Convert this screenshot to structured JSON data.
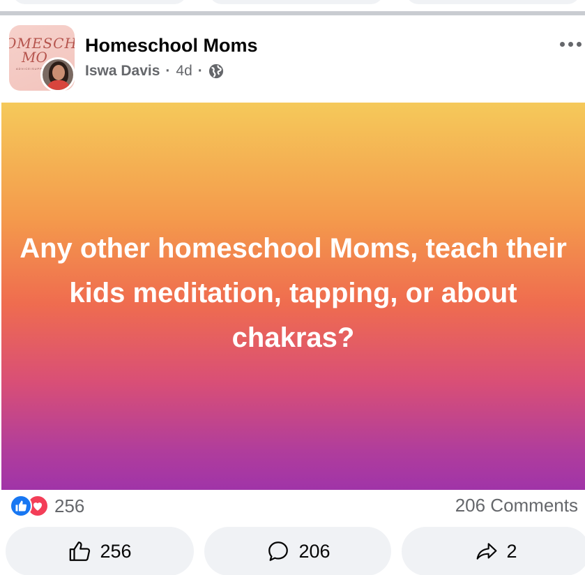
{
  "post": {
    "group_name": "Homeschool Moms",
    "author": "Iswa Davis",
    "separator": "·",
    "time_ago": "4d",
    "privacy_icon": "globe-icon",
    "body_text": "Any other homeschool Moms, teach their kids meditation, tapping, or about chakras?",
    "background_gradient": [
      "#f5c95a",
      "#ef6c4f",
      "#a034a8"
    ]
  },
  "group_avatar": {
    "logo_line1": "OMESCHOO",
    "logo_line2": "MO",
    "logo_sub": "ADVICE/SUPP"
  },
  "reactions": {
    "icons": [
      "like-icon",
      "love-icon"
    ],
    "count": "256",
    "comments_label": "206 Comments"
  },
  "actions": {
    "like_count": "256",
    "comment_count": "206",
    "share_count": "2"
  },
  "colors": {
    "like_blue": "#1877f2",
    "love_red": "#f33e58",
    "muted_text": "#65676b",
    "button_bg": "#f0f2f5"
  }
}
